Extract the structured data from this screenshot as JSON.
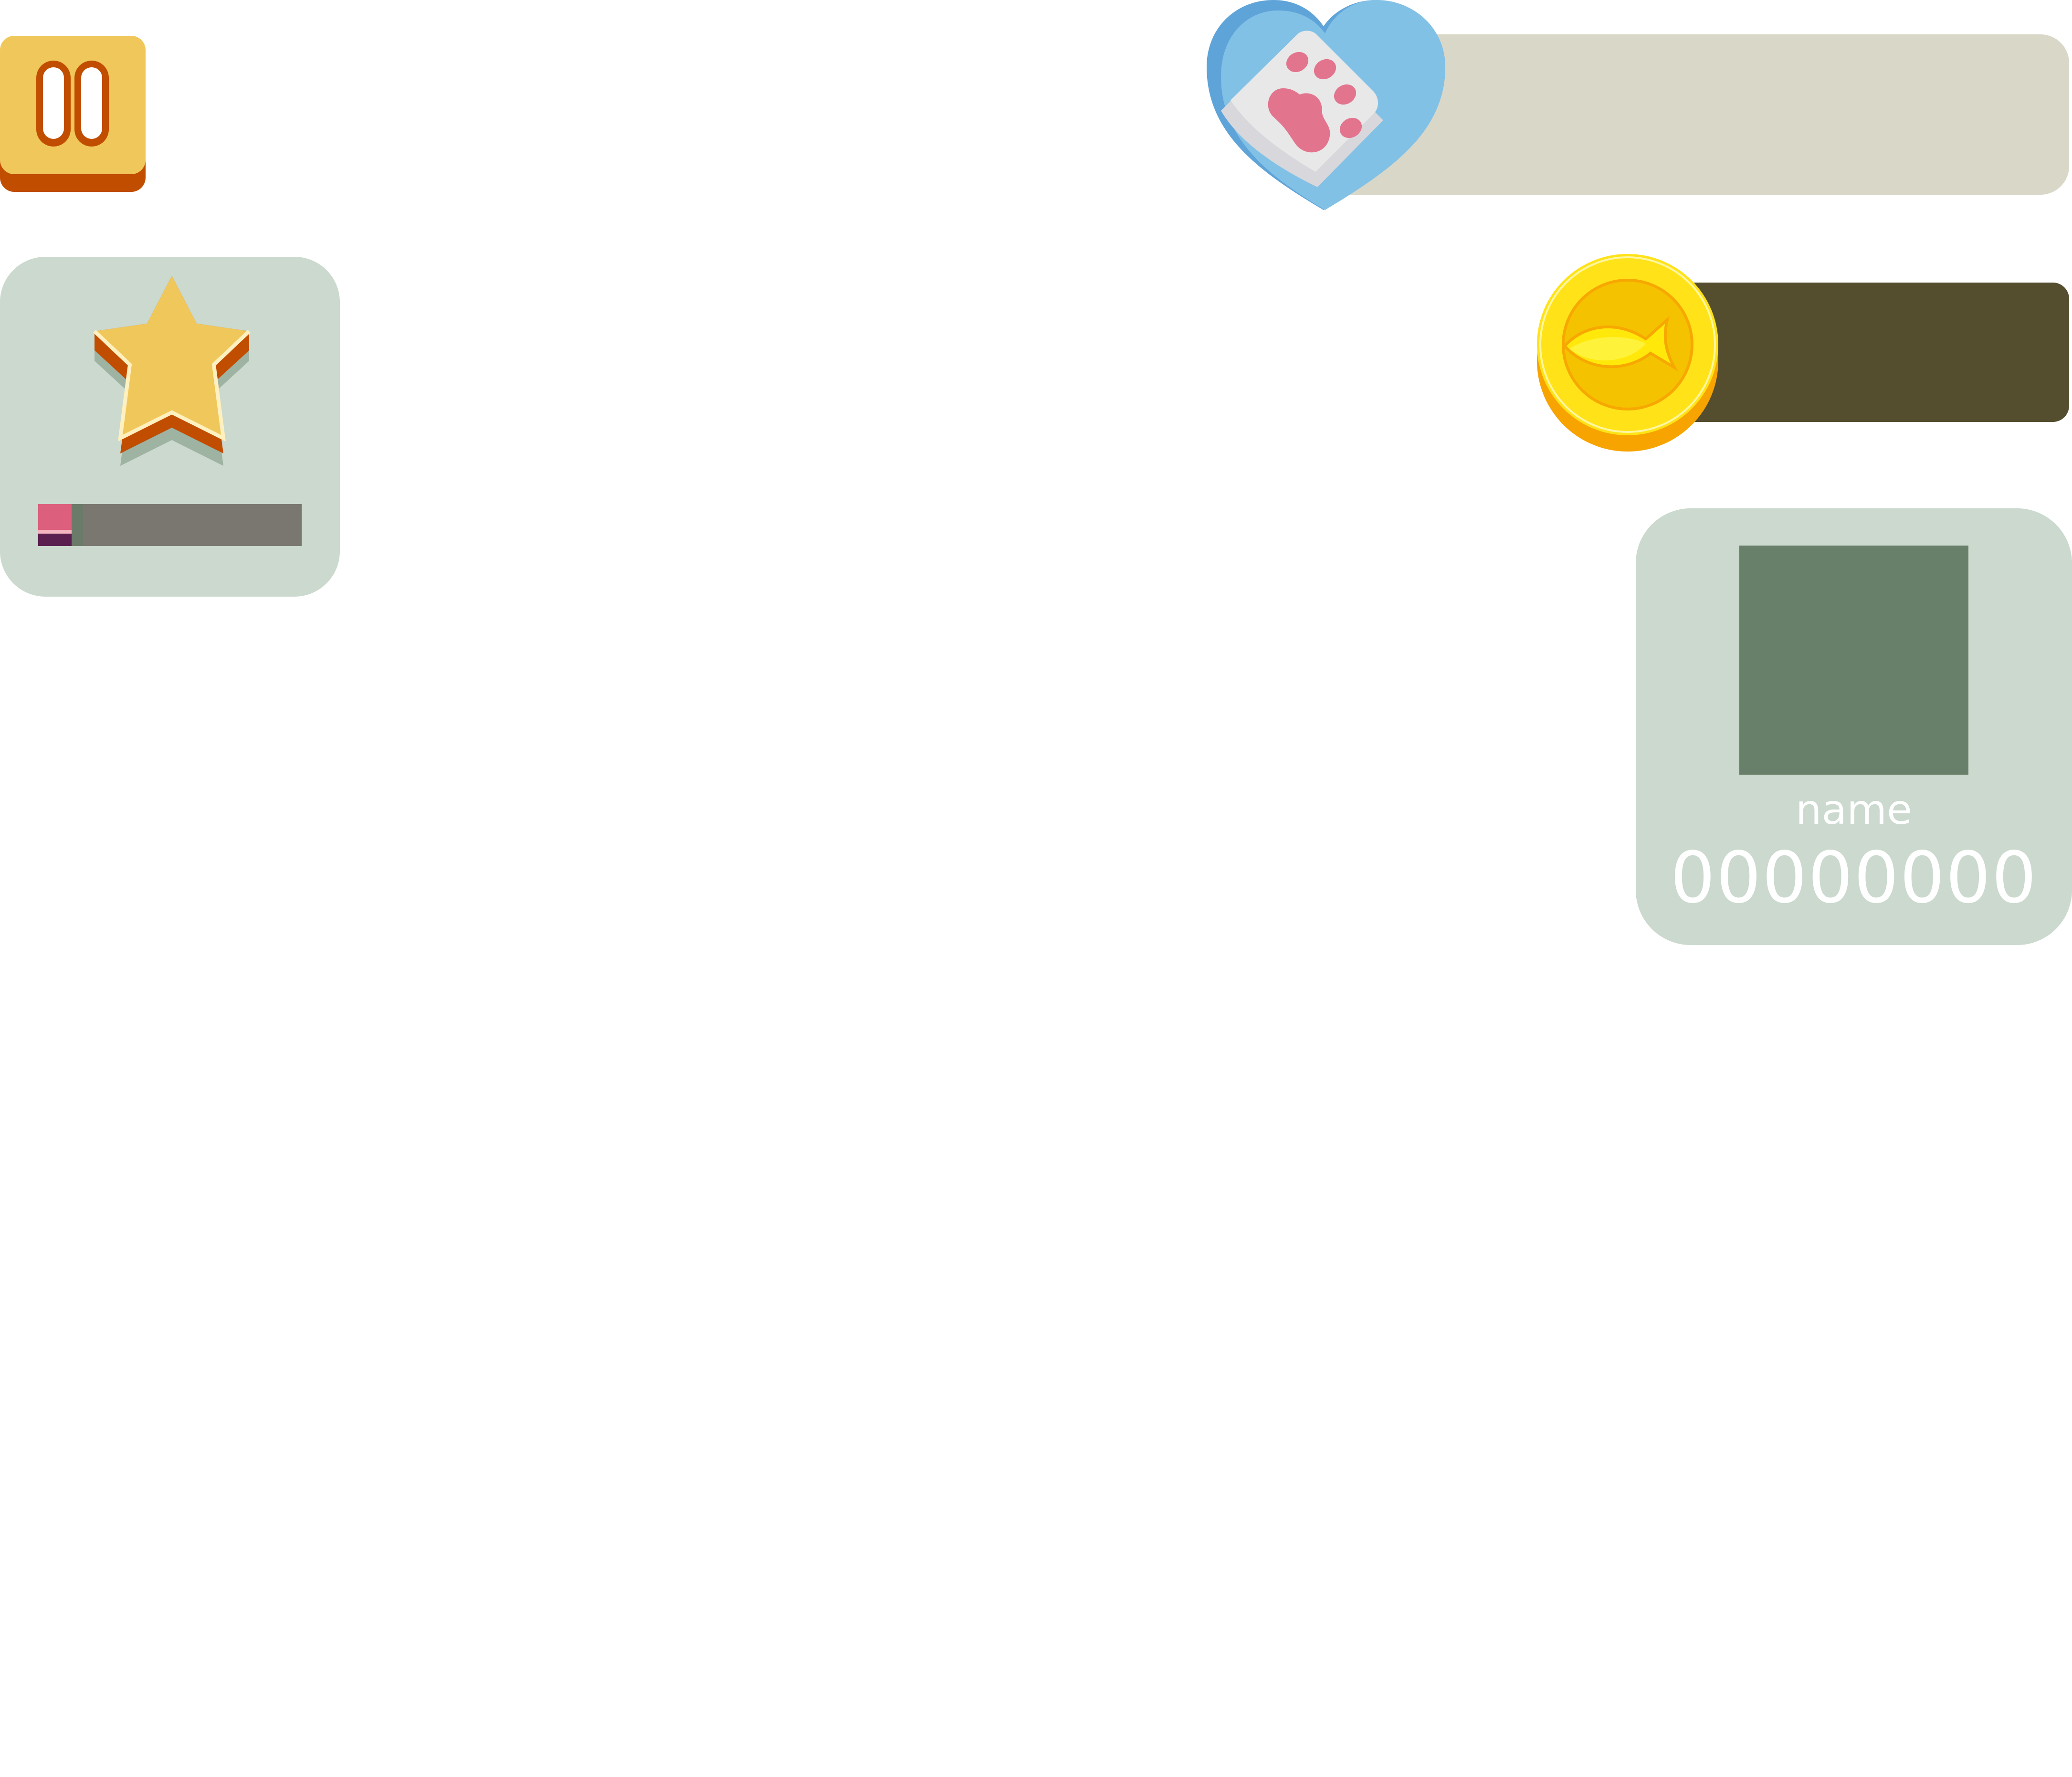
{
  "pause_button": {
    "icon": "pause-icon",
    "color": "#f0c75a",
    "shadow_color": "#c14d00"
  },
  "level_panel": {
    "icon": "star-icon",
    "progress_fraction": 0.17,
    "colors": {
      "panel": "#cbd9ce",
      "fill": "#dc5f7d",
      "track": "#7a7770"
    }
  },
  "health": {
    "icon": "heart-paw-icon",
    "bar_color": "#d9d7c8"
  },
  "coins": {
    "icon": "fish-coin-icon",
    "bar_color": "#544d2e"
  },
  "player_card": {
    "name": "name",
    "score": "00000000",
    "avatar_color": "#687f69"
  }
}
